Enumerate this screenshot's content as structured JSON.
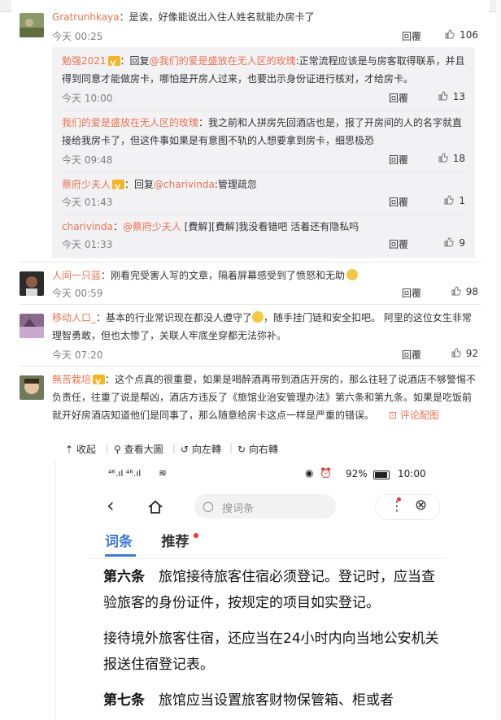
{
  "comments": [
    {
      "user": "Gratrunhkaya",
      "text": "：是诶，好像能说出入住人姓名就能办房卡了",
      "time": "今天 00:25",
      "reply": "回覆",
      "likes": "106"
    },
    {
      "user": "人间一只蓝",
      "text": "：刚看完受害人写的文章，隔着屏幕感受到了愤怒和无助",
      "time": "今天 00:59",
      "reply": "回覆",
      "likes": "98"
    },
    {
      "user": "移动人口_",
      "text_a": "：基本的行业常识现在都没人遵守了",
      "text_b": "，随手挂门链和安全扣吧。 阿里的这位女生非常理智勇敢，但也太惨了，关联人牢底坐穿都无法弥补。",
      "time": "今天 07:20",
      "reply": "回覆",
      "likes": "92"
    },
    {
      "user": "無苦栽培",
      "text": "：这个点真的很重要，如果是喝醉酒再带到酒店开房的，那么往轻了说酒店不够警惕不负责任，往重了说是帮凶，酒店方违反了《旅馆业治安管理办法》第六条和第九条。如果是吃饭前就开好房酒店知道他们是同事了，那么随意给房卡这点一样是严重的错误。",
      "pic_link": "评论配图"
    }
  ],
  "replies": [
    {
      "user": "勉强2021",
      "reply_prefix": "：回复",
      "mention": "@我们的爱是盛放在无人区的玫瑰",
      "text": ":正常流程应该是与房客取得联系，并且得到同意才能做房卡，哪怕是开房人过来，也要出示身份证进行核对，才给房卡。",
      "time": "今天 10:00",
      "reply": "回覆",
      "likes": "13"
    },
    {
      "user": "我们的爱是盛放在无人区的玫瑰",
      "text": "：我之前和人拼房先回酒店也是，报了开房间的人的名字就直接给我房卡了，但这件事如果是有意图不轨的人想要拿到房卡，细思极恐",
      "time": "今天 09:48",
      "reply": "回覆",
      "likes": "18"
    },
    {
      "user": "蔡府少夫人",
      "reply_prefix": "：回复",
      "mention": "@charivinda",
      "text": ":管理疏忽",
      "time": "今天 01:43",
      "reply": "回覆",
      "likes": "1"
    },
    {
      "user": "charivinda",
      "reply_prefix": "：",
      "mention": "@蔡府少夫人",
      "text": " [費解][費解]我没看错吧 活着还有隐私吗",
      "time": "今天 01:33",
      "reply": "回覆",
      "likes": "9"
    }
  ],
  "picture_toolbar": {
    "collapse": "收起",
    "view_large": "查看大圖",
    "rotate_left": "向左轉",
    "rotate_right": "向右轉"
  },
  "screenshot": {
    "signal": "⁴⁶.ıl ⁴⁶.ıl",
    "battery": "92%",
    "time": "10:00",
    "search_placeholder": "搜词条",
    "tab_active": "词条",
    "tab_other": "推荐",
    "para1_title": "第六条",
    "para1_text": "　旅馆接待旅客住宿必须登记。登记时，应当查验旅客的身份证件，按规定的项目如实登记。",
    "para2_text": "接待境外旅客住宿，还应当在24小时内向当地公安机关报送住宿登记表。",
    "para3_title": "第七条",
    "para3_text": "　旅馆应当设置旅客财物保管箱、柜或者"
  },
  "colors": {
    "username": "#eb7350",
    "sub_bg": "#f2f2f5",
    "tab_blue": "#3b79d8"
  }
}
